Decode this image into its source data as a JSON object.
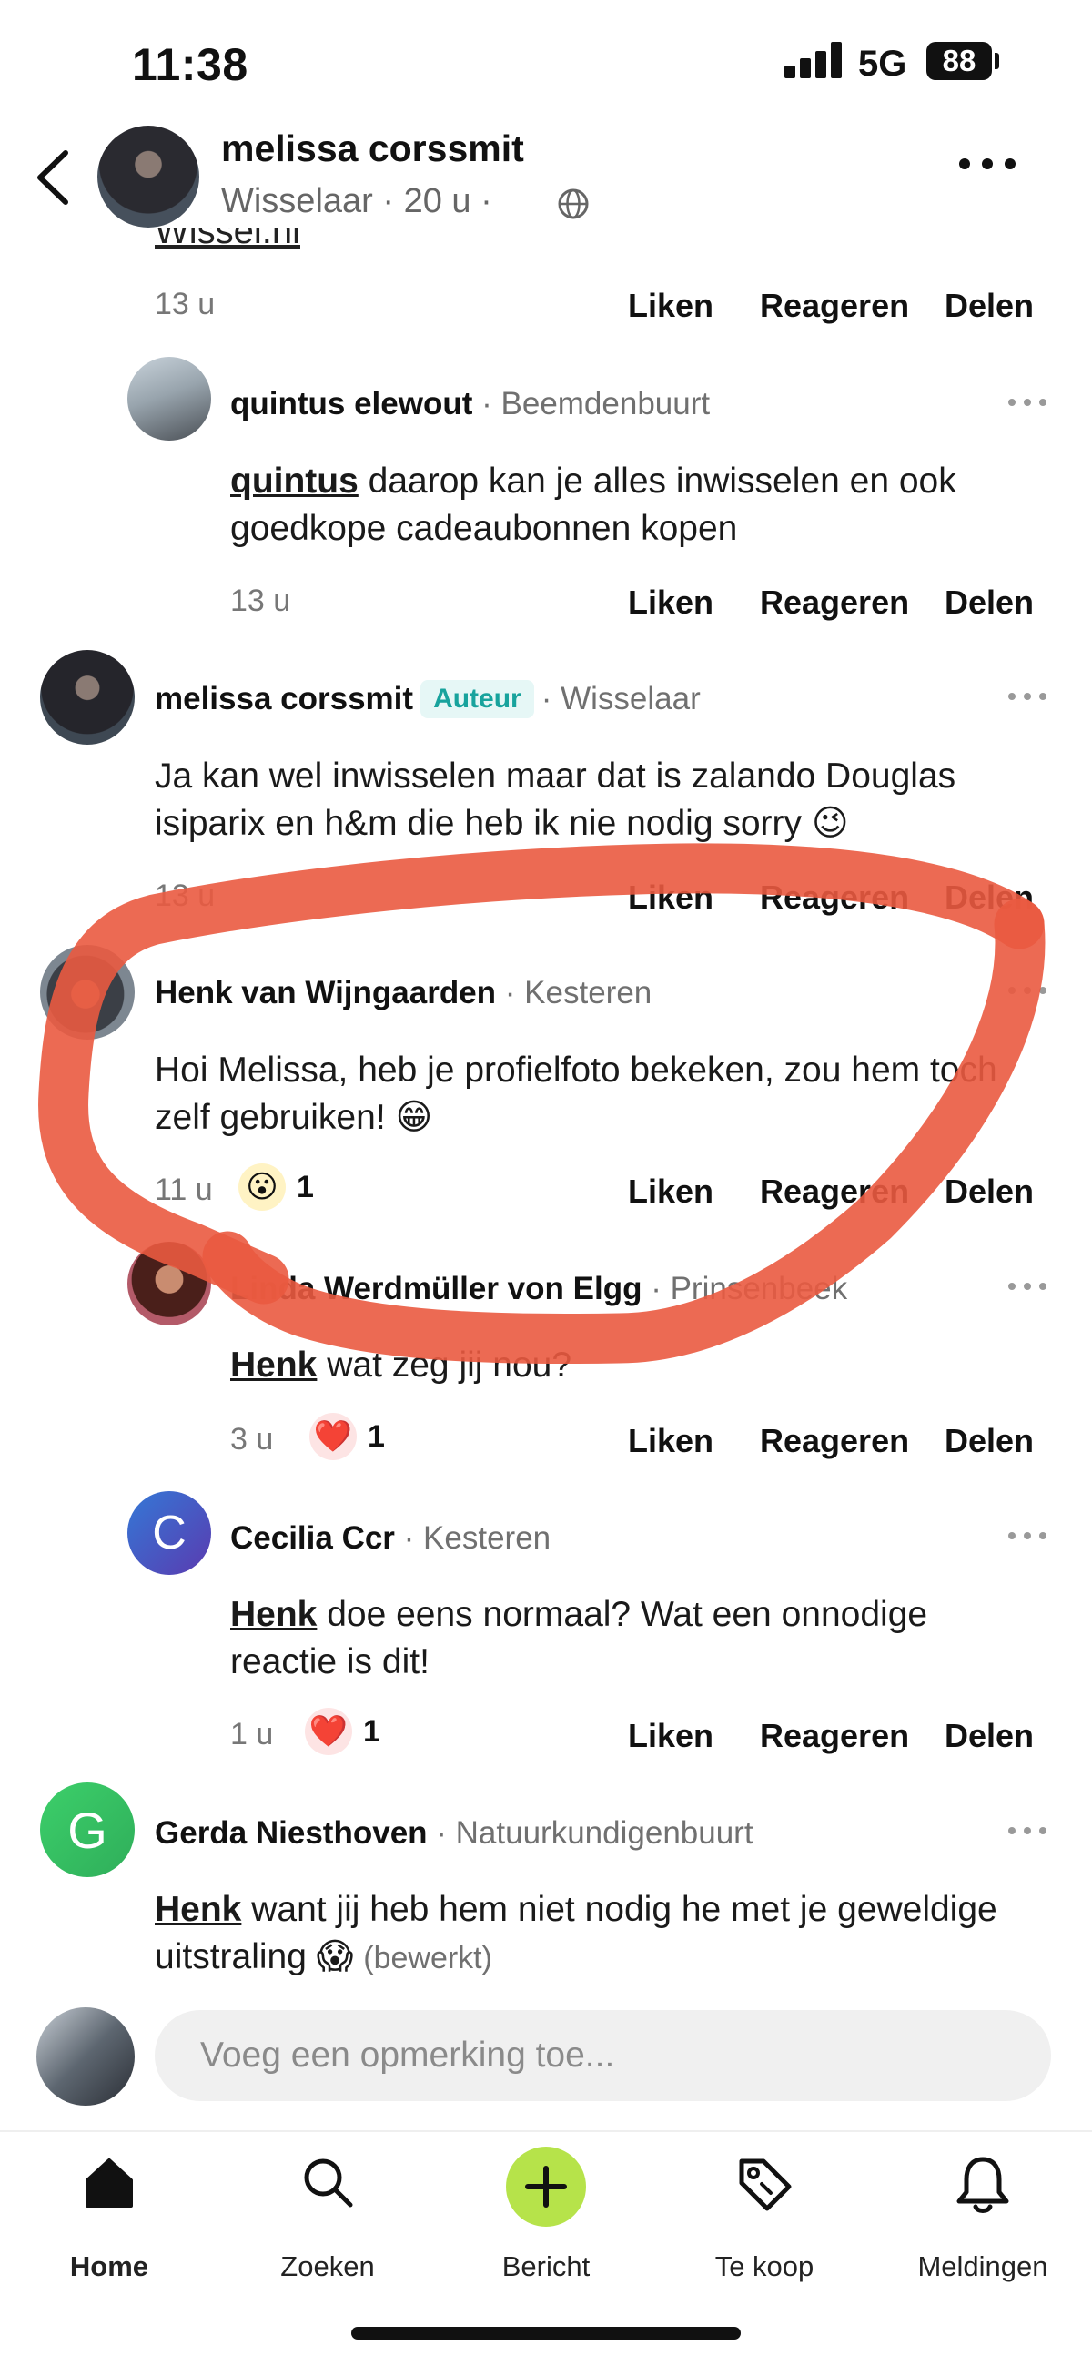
{
  "status_bar": {
    "time": "11:38",
    "network": "5G",
    "battery": "88"
  },
  "header": {
    "name": "melissa corssmit",
    "subtitle": "Wisselaar · 20 u ·"
  },
  "cut_link": "Wissel.nl",
  "actions": {
    "like": "Liken",
    "reply": "Reageren",
    "share": "Delen"
  },
  "comments": [
    {
      "time": "13 u"
    },
    {
      "name": "quintus elewout",
      "loc": "· Beemdenbuurt",
      "mention": "quintus",
      "text": " daarop kan je alles inwisselen en ook goedkope cadeaubonnen kopen",
      "time": "13 u"
    },
    {
      "name": "melissa corssmit",
      "badge": "Auteur",
      "loc": "· Wisselaar",
      "text": "Ja kan wel inwisselen maar dat is zalando Douglas isiparix en h&m die heb ik nie nodig sorry 😉",
      "time": "13 u"
    },
    {
      "name": "Henk van Wijngaarden",
      "loc": "· Kesteren",
      "text": "Hoi Melissa, heb je profielfoto bekeken, zou hem toch zelf gebruiken! 😁",
      "time": "11 u",
      "reaction_icon": "😮",
      "reaction_count": "1"
    },
    {
      "name": "Linda Werdmüller von Elgg",
      "loc": "· Prinsenbeek",
      "mention": "Henk",
      "text": " wat zeg jij nou?",
      "time": "3 u",
      "reaction_icon": "❤️",
      "reaction_count": "1"
    },
    {
      "name": "Cecilia Ccr",
      "loc": "· Kesteren",
      "avatar_letter": "C",
      "mention": "Henk",
      "text": " doe eens normaal? Wat een onnodige reactie is dit!",
      "time": "1 u",
      "reaction_icon": "❤️",
      "reaction_count": "1"
    },
    {
      "name": "Gerda Niesthoven",
      "loc": "· Natuurkundigenbuurt",
      "avatar_letter": "G",
      "mention": "Henk",
      "text": " want jij heb hem niet nodig he met je geweldige uitstraling 😱",
      "edited": "(bewerkt)"
    }
  ],
  "comment_input": {
    "placeholder": "Voeg een opmerking toe..."
  },
  "nav": [
    {
      "label": "Home",
      "icon": "home-icon",
      "active": true
    },
    {
      "label": "Zoeken",
      "icon": "search-icon"
    },
    {
      "label": "Bericht",
      "icon": "plus-icon"
    },
    {
      "label": "Te koop",
      "icon": "tag-icon"
    },
    {
      "label": "Meldingen",
      "icon": "bell-icon"
    }
  ],
  "colors": {
    "accent_green": "#b6e34a",
    "author_badge": "#18a39d",
    "annotation_red": "#ea5a40",
    "heart": "#e5484d"
  }
}
